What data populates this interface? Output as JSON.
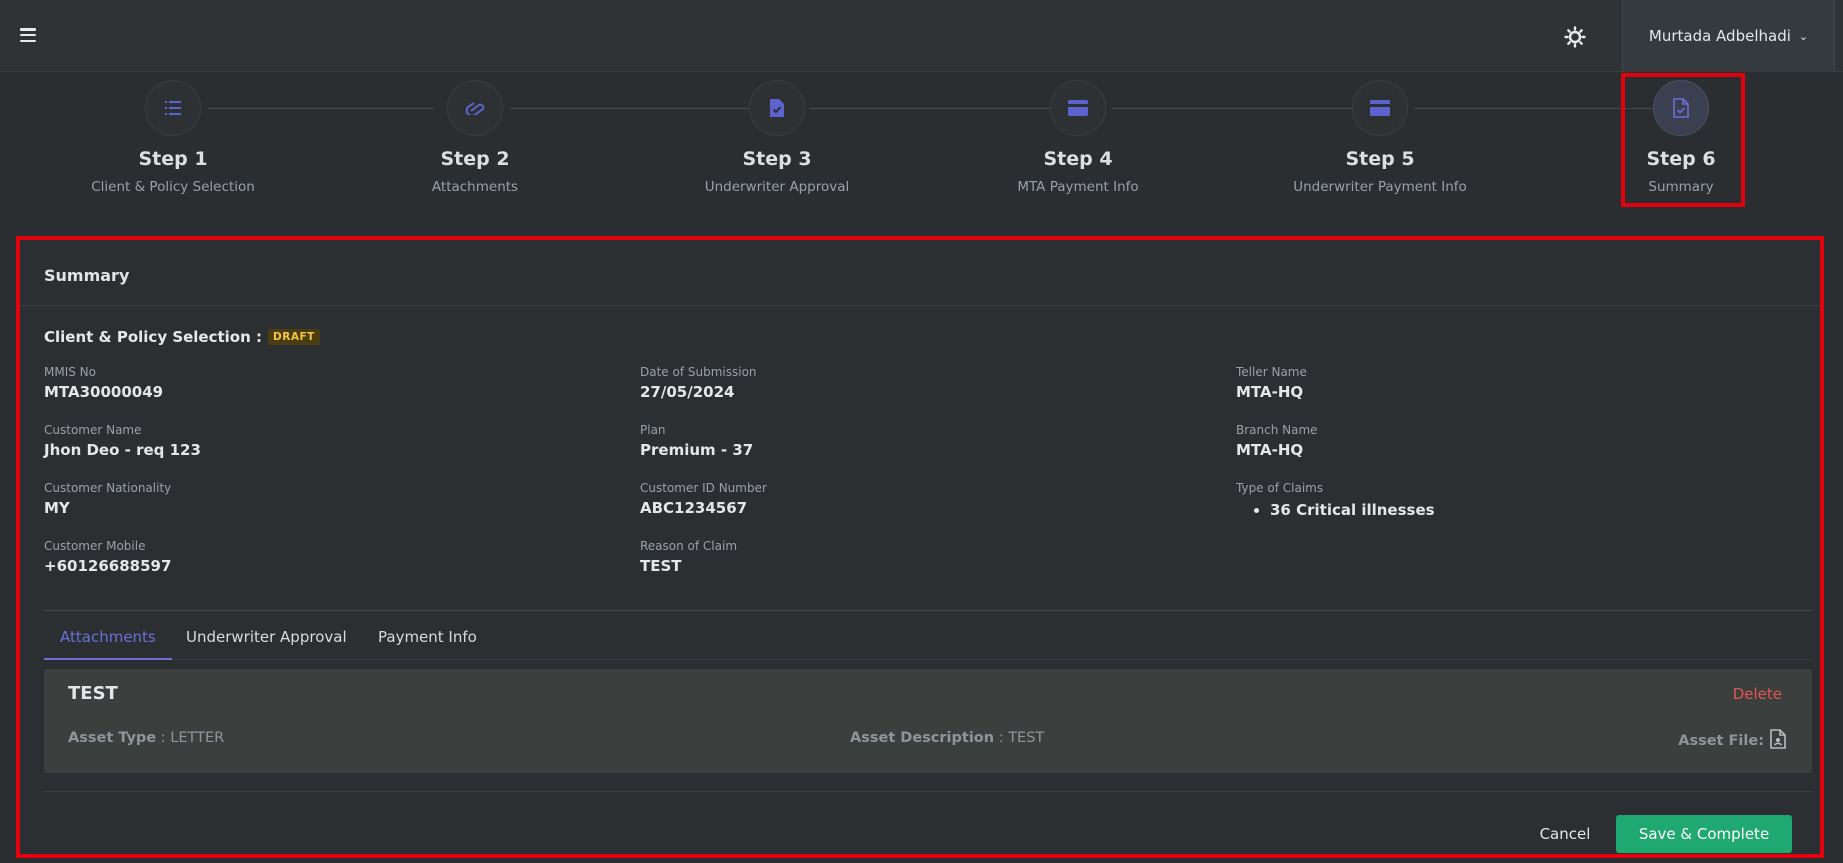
{
  "header": {
    "user_name": "Murtada Adbelhadi"
  },
  "steps": [
    {
      "title": "Step 1",
      "subtitle": "Client & Policy Selection",
      "icon": "list-icon"
    },
    {
      "title": "Step 2",
      "subtitle": "Attachments",
      "icon": "paperclip-icon"
    },
    {
      "title": "Step 3",
      "subtitle": "Underwriter Approval",
      "icon": "file-check-icon"
    },
    {
      "title": "Step 4",
      "subtitle": "MTA Payment Info",
      "icon": "credit-card-icon"
    },
    {
      "title": "Step 5",
      "subtitle": "Underwriter Payment Info",
      "icon": "credit-card-icon"
    },
    {
      "title": "Step 6",
      "subtitle": "Summary",
      "icon": "file-check-icon",
      "active": true
    }
  ],
  "summary": {
    "heading": "Summary",
    "section_title": "Client & Policy Selection :",
    "status_badge": "DRAFT",
    "fields": {
      "mmis_no": {
        "label": "MMIS No",
        "value": "MTA30000049"
      },
      "date_of_submission": {
        "label": "Date of Submission",
        "value": "27/05/2024"
      },
      "teller_name": {
        "label": "Teller Name",
        "value": "MTA-HQ"
      },
      "customer_name": {
        "label": "Customer Name",
        "value": "Jhon Deo - req 123"
      },
      "plan": {
        "label": "Plan",
        "value": "Premium - 37"
      },
      "branch_name": {
        "label": "Branch Name",
        "value": "MTA-HQ"
      },
      "customer_nationality": {
        "label": "Customer Nationality",
        "value": "MY"
      },
      "customer_id_number": {
        "label": "Customer ID Number",
        "value": "ABC1234567"
      },
      "type_of_claims": {
        "label": "Type of Claims",
        "items": [
          "36 Critical illnesses"
        ]
      },
      "customer_mobile": {
        "label": "Customer Mobile",
        "value": "+60126688597"
      },
      "reason_of_claim": {
        "label": "Reason of Claim",
        "value": "TEST"
      }
    }
  },
  "tabs": [
    {
      "label": "Attachments",
      "active": true
    },
    {
      "label": "Underwriter Approval"
    },
    {
      "label": "Payment Info"
    }
  ],
  "attachment": {
    "title": "TEST",
    "delete_label": "Delete",
    "asset_type_label": "Asset Type",
    "asset_type_value": ": LETTER",
    "asset_description_label": "Asset Description",
    "asset_description_value": ": TEST",
    "asset_file_label": "Asset File:"
  },
  "actions": {
    "cancel_label": "Cancel",
    "save_label": "Save & Complete"
  },
  "colors": {
    "accent": "#6a70d8",
    "primary_button": "#1fa870",
    "danger": "#e15555",
    "badge_text": "#f6c443",
    "highlight_box": "#e3000f"
  }
}
